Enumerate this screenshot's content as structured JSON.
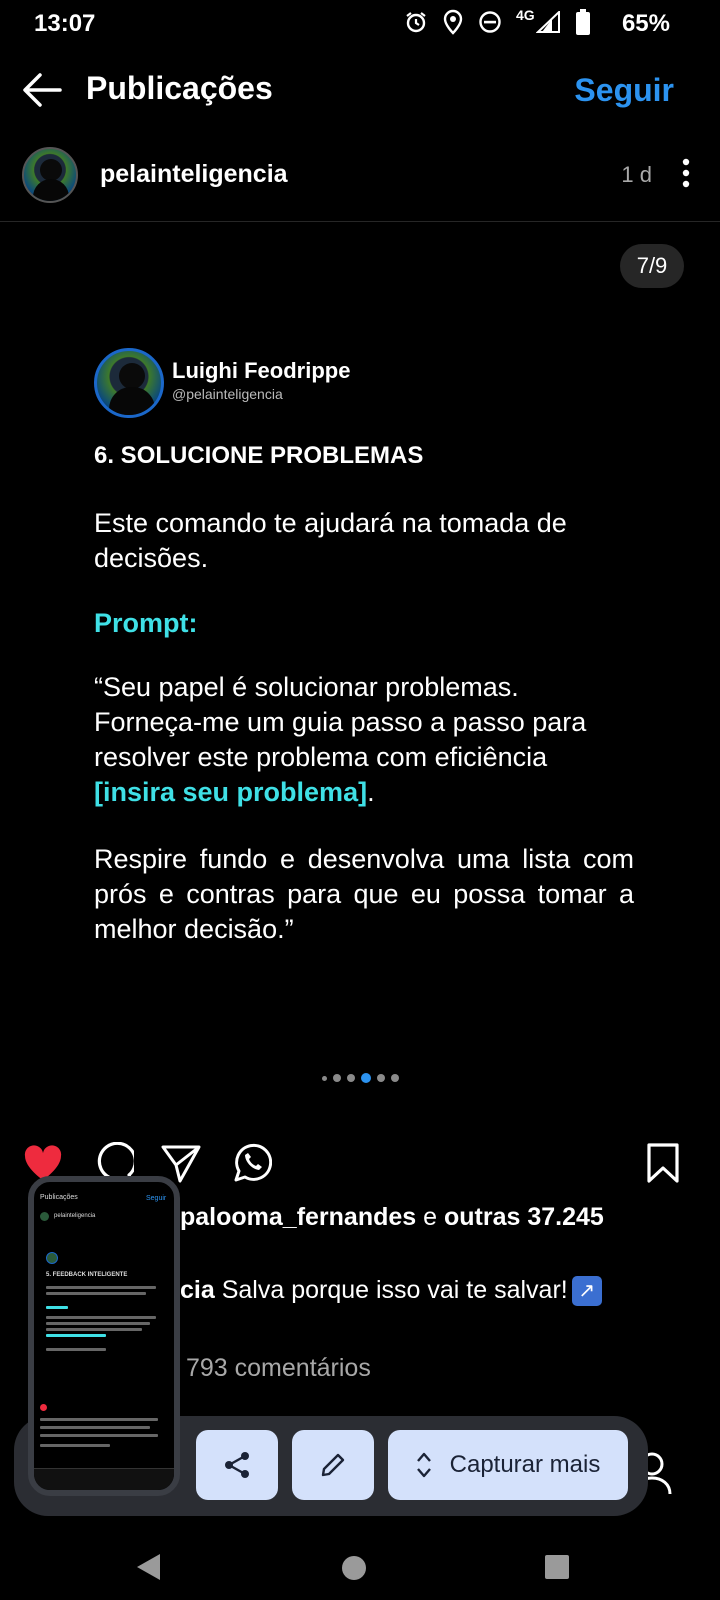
{
  "status": {
    "time": "13:07",
    "battery": "65%",
    "network": "4G"
  },
  "header": {
    "title": "Publicações",
    "follow": "Seguir"
  },
  "post": {
    "author": "pelainteligencia",
    "time": "1 d",
    "counter": "7/9",
    "slide": {
      "name": "Luighi Feodrippe",
      "handle": "@pelainteligencia",
      "heading": "6. SOLUCIONE PROBLEMAS",
      "intro": "Este comando te ajudará na tomada de decisões.",
      "prompt_label": "Prompt:",
      "quote_start": "“Seu papel é solucionar problemas. Forneça-me um guia passo a passo para resolver este problema com eficiência ",
      "quote_highlight": "[insira seu problema]",
      "quote_end": ".",
      "quote2": "Respire fundo e desenvolva uma lista com prós e contras para que eu possa tomar a melhor decisão.”"
    },
    "dots": {
      "count": 6,
      "active_index": 3
    },
    "likes": {
      "user": "palooma_fernandes",
      "connector": "e",
      "others": "outras 37.245"
    },
    "caption": {
      "user_fragment": "cia",
      "text": "Salva porque isso vai te salvar!"
    },
    "comments": "793 comentários"
  },
  "thumbnail": {
    "title": "Publicações",
    "follow": "Seguir",
    "author": "pelainteligencia",
    "heading": "5. FEEDBACK INTELIGENTE"
  },
  "capture": {
    "more_label": "Capturar mais"
  },
  "colors": {
    "accent": "#2c93f0",
    "highlight": "#3fe0e6",
    "like": "#ee2b3e"
  }
}
